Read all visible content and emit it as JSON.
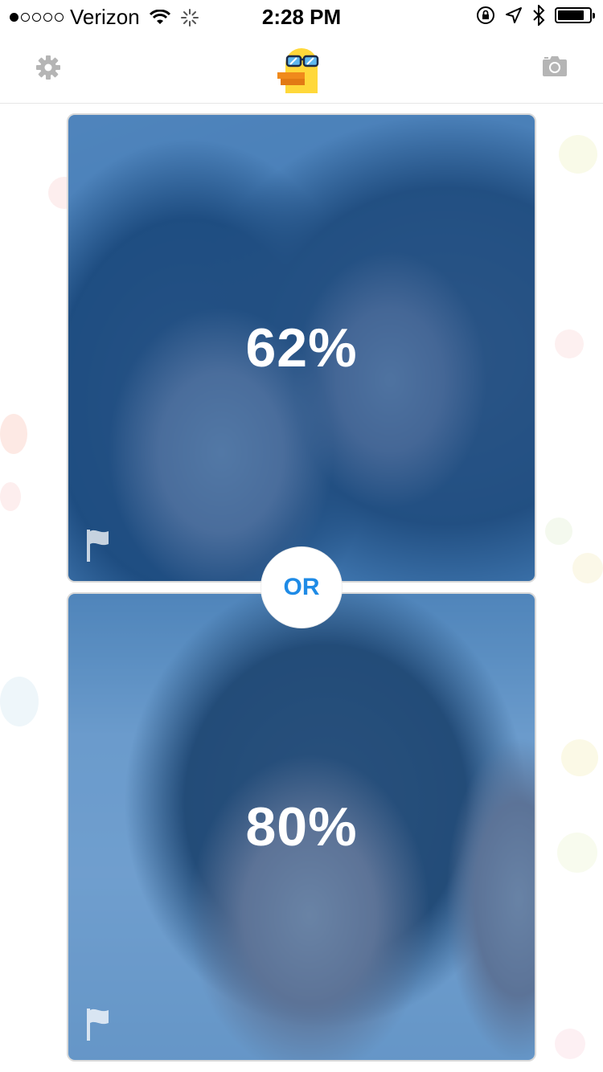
{
  "status_bar": {
    "carrier": "Verizon",
    "time": "2:28 PM",
    "signal_bars_filled": 1,
    "signal_bars_total": 5,
    "battery_level": 0.85
  },
  "nav_bar": {
    "left_icon": "gear-icon",
    "center_logo": "duck-with-sunglasses-logo",
    "right_icon": "camera-icon"
  },
  "cards": [
    {
      "percent": "62%",
      "flag_icon": "flag-icon"
    },
    {
      "percent": "80%",
      "flag_icon": "flag-icon"
    }
  ],
  "or_label": "OR",
  "colors": {
    "overlay_blue": "#195faa",
    "or_text": "#1f8be6",
    "icon_gray": "#b5b5b5",
    "logo_yellow": "#ffd83a",
    "logo_beak": "#f08a1c"
  }
}
